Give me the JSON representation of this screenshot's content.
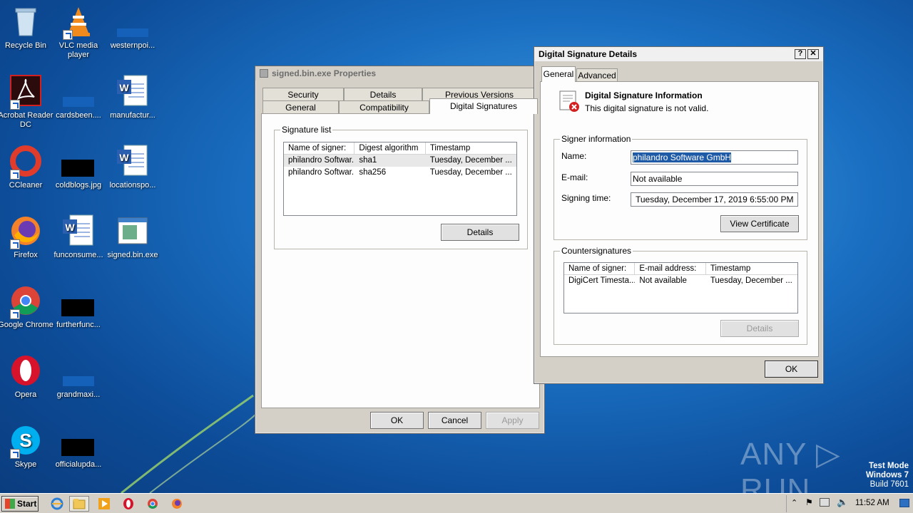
{
  "desktop": {
    "icons": [
      {
        "label": "Recycle Bin"
      },
      {
        "label": "VLC media player"
      },
      {
        "label": "westernpoi..."
      },
      {
        "label": "Acrobat Reader DC"
      },
      {
        "label": "cardsbeen...."
      },
      {
        "label": "manufactur..."
      },
      {
        "label": "CCleaner"
      },
      {
        "label": "coldblogs.jpg"
      },
      {
        "label": "locationspo..."
      },
      {
        "label": "Firefox"
      },
      {
        "label": "funconsume..."
      },
      {
        "label": "signed.bin.exe"
      },
      {
        "label": "Google Chrome"
      },
      {
        "label": "furtherfunc..."
      },
      {
        "label": "Opera"
      },
      {
        "label": "grandmaxi..."
      },
      {
        "label": "Skype"
      },
      {
        "label": "officialupda..."
      }
    ]
  },
  "properties": {
    "title": "signed.bin.exe Properties",
    "tabs": [
      "Security",
      "Details",
      "Previous Versions",
      "General",
      "Compatibility",
      "Digital Signatures"
    ],
    "group_label": "Signature list",
    "columns": [
      "Name of signer:",
      "Digest algorithm",
      "Timestamp"
    ],
    "rows": [
      [
        "philandro Softwar...",
        "sha1",
        "Tuesday, December ..."
      ],
      [
        "philandro Softwar...",
        "sha256",
        "Tuesday, December ..."
      ]
    ],
    "details_button": "Details",
    "ok": "OK",
    "cancel": "Cancel",
    "apply": "Apply"
  },
  "signature": {
    "title": "Digital Signature Details",
    "help": "?",
    "close": "✕",
    "tabs": [
      "General",
      "Advanced"
    ],
    "info_heading": "Digital Signature Information",
    "info_status": "This digital signature is not valid.",
    "signer_group": "Signer information",
    "name_label": "Name:",
    "name_value": "philandro Software GmbH",
    "email_label": "E-mail:",
    "email_value": "Not available",
    "time_label": "Signing time:",
    "time_value": "Tuesday,   December   17,   2019 6:55:00 PM",
    "view_cert": "View Certificate",
    "counter_group": "Countersignatures",
    "counter_columns": [
      "Name of signer:",
      "E-mail address:",
      "Timestamp"
    ],
    "counter_rows": [
      [
        "DigiCert Timesta...",
        "Not available",
        "Tuesday, December ..."
      ]
    ],
    "details": "Details",
    "ok": "OK"
  },
  "taskbar": {
    "start": "Start",
    "clock": "11:52 AM"
  },
  "watermark": {
    "brand": "ANY ▷ RUN",
    "line1": "Test Mode",
    "line2": "Windows 7",
    "line3": "Build 7601"
  },
  "colors": {
    "selection": "#1f5aa6",
    "error_red": "#d32020"
  }
}
